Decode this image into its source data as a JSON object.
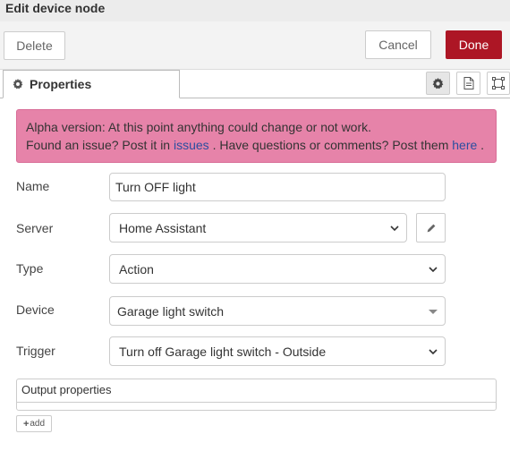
{
  "window": {
    "title": "Edit device node"
  },
  "toolbar": {
    "delete_label": "Delete",
    "cancel_label": "Cancel",
    "done_label": "Done",
    "done_color": "#ad1625"
  },
  "tabs": {
    "properties_label": "Properties"
  },
  "alert": {
    "line1": "Alpha version: At this point anything could change or not work.",
    "line2_a": "Found an issue? Post it in ",
    "issues_link": "issues",
    "line2_b": " . Have questions or comments? Post them ",
    "here_link": "here",
    "line2_c": " .",
    "bg_color": "#e683a9"
  },
  "form": {
    "name": {
      "label": "Name",
      "value": "Turn OFF light"
    },
    "server": {
      "label": "Server",
      "value": "Home Assistant"
    },
    "type": {
      "label": "Type",
      "value": "Action"
    },
    "device": {
      "label": "Device",
      "value": "Garage light switch"
    },
    "trigger": {
      "label": "Trigger",
      "value": "Turn off Garage light switch - Outside"
    }
  },
  "output": {
    "label": "Output properties",
    "add_label": "add"
  }
}
